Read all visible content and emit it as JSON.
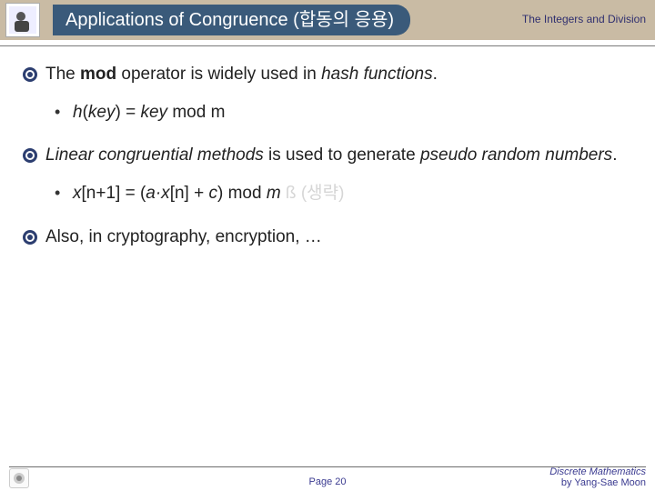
{
  "header": {
    "title": "Applications of Congruence (합동의 응용)",
    "chapter": "The Integers and Division"
  },
  "body": {
    "line1_pre": "The ",
    "line1_b": "mod",
    "line1_mid": " operator is widely used in ",
    "line1_ital": "hash functions",
    "line1_end": ".",
    "sub1_pre": "h",
    "sub1_mid": "(",
    "sub1_key1": "key",
    "sub1_mid2": ") = ",
    "sub1_key2": "key",
    "sub1_end": " mod m",
    "line2_ital": "Linear congruential methods",
    "line2_mid": " is used to generate ",
    "line2_ital2": "pseudo random numbers",
    "line2_end": ".",
    "sub2_pre": "x",
    "sub2_a": "[n+1] = (",
    "sub2_b": "a·x",
    "sub2_c": "[n] + ",
    "sub2_d": "c",
    "sub2_e": ") mod ",
    "sub2_f": "m",
    "sub2_arrow": "  ß (생략)",
    "line3": "Also, in cryptography, encryption, …"
  },
  "footer": {
    "page": "Page 20",
    "course": "Discrete Mathematics",
    "author": "by Yang-Sae Moon",
    "uni": ""
  }
}
